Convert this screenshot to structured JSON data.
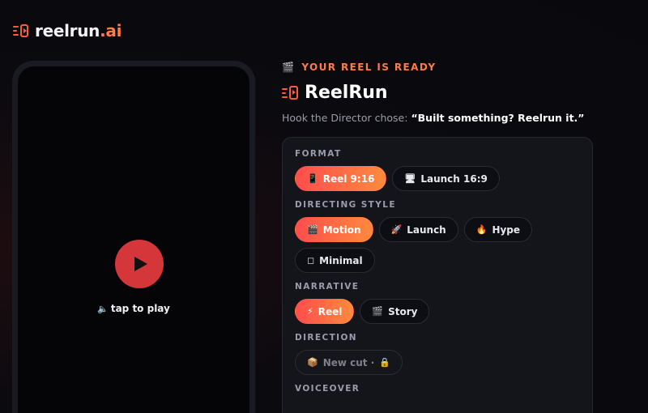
{
  "brand": {
    "name_main": "reelrun",
    "name_suffix": ".ai"
  },
  "player": {
    "tap_label": "tap to play",
    "speaker_icon": "speaker-icon"
  },
  "result": {
    "eyebrow": "YOUR REEL IS READY",
    "title": "ReelRun",
    "hook_prefix": "Hook the Director chose:",
    "hook_quote": "“Built something? Reelrun it.”"
  },
  "options": {
    "format": {
      "label": "FORMAT",
      "items": [
        {
          "icon": "📱",
          "label": "Reel 9:16",
          "active": true
        },
        {
          "icon": "🖥",
          "label": "Launch 16:9",
          "active": false
        }
      ]
    },
    "style": {
      "label": "DIRECTING STYLE",
      "items": [
        {
          "icon": "🎬",
          "label": "Motion",
          "active": true
        },
        {
          "icon": "🚀",
          "label": "Launch",
          "active": false
        },
        {
          "icon": "🔥",
          "label": "Hype",
          "active": false
        },
        {
          "icon": "◻",
          "label": "Minimal",
          "active": false
        }
      ]
    },
    "narrative": {
      "label": "NARRATIVE",
      "items": [
        {
          "icon": "⚡",
          "label": "Reel",
          "active": true
        },
        {
          "icon": "🎬",
          "label": "Story",
          "active": false
        }
      ]
    },
    "direction": {
      "label": "DIRECTION",
      "items": [
        {
          "icon": "📦",
          "label": "New cut ·",
          "lock": "🔒"
        }
      ]
    },
    "voiceover": {
      "label": "VOICEOVER"
    }
  },
  "colors": {
    "accent": "#ff5a3c",
    "accent_light": "#ff7a45",
    "play": "#d4363a",
    "bg": "#0b0a0f"
  }
}
